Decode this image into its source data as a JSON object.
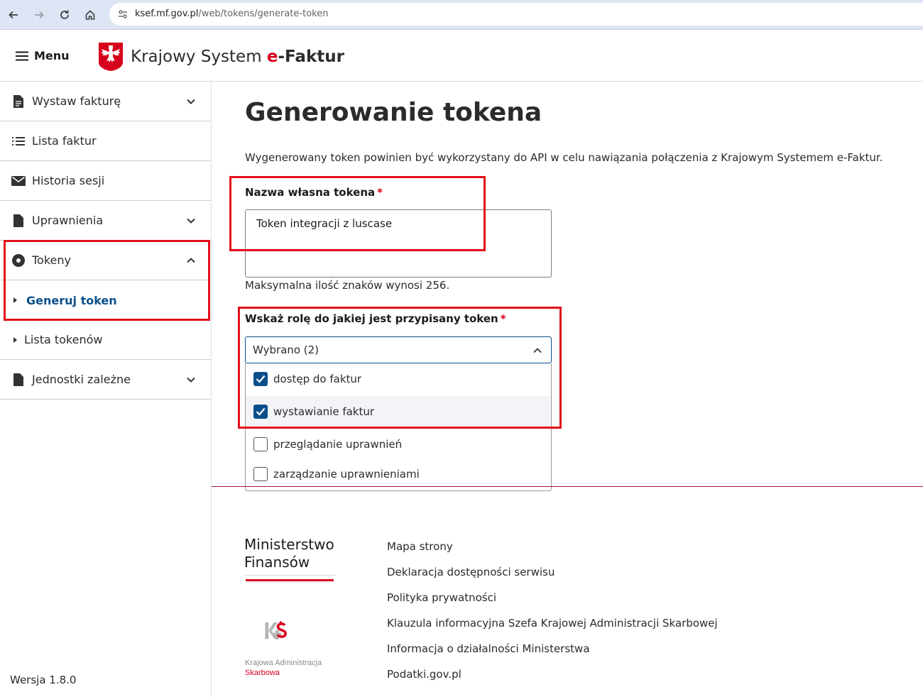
{
  "browser": {
    "url_host": "ksef.mf.gov.pl",
    "url_path": "/web/tokens/generate-token"
  },
  "header": {
    "menu_label": "Menu",
    "brand_part1": "Krajowy System ",
    "brand_e": "e",
    "brand_part2": "-Faktur"
  },
  "sidebar": {
    "items": [
      {
        "label": "Wystaw fakturę",
        "icon": "document-icon",
        "expandable": true
      },
      {
        "label": "Lista faktur",
        "icon": "list-icon",
        "expandable": false
      },
      {
        "label": "Historia sesji",
        "icon": "mail-icon",
        "expandable": false
      },
      {
        "label": "Uprawnienia",
        "icon": "document-icon",
        "expandable": true
      },
      {
        "label": "Tokeny",
        "icon": "token-icon",
        "expandable": true,
        "expanded": true
      }
    ],
    "sub_items": [
      {
        "label": "Generuj token",
        "active": true
      },
      {
        "label": "Lista tokenów",
        "active": false
      }
    ],
    "last_item": {
      "label": "Jednostki zależne",
      "icon": "document-icon",
      "expandable": true
    },
    "version": "Wersja 1.8.0"
  },
  "main": {
    "title": "Generowanie tokena",
    "description": "Wygenerowany token powinien być wykorzystany do API w celu nawiązania połączenia z Krajowym Systemem e-Faktur.",
    "name_label": "Nazwa własna tokena",
    "required_mark": "*",
    "name_value": "Token integracji z luscase",
    "hint": "Maksymalna ilość znaków wynosi 256.",
    "role_label": "Wskaż rolę do jakiej jest przypisany token",
    "role_selected": "Wybrano (2)",
    "role_options": [
      {
        "label": "dostęp do faktur",
        "checked": true
      },
      {
        "label": "wystawianie faktur",
        "checked": true
      },
      {
        "label": "przeglądanie uprawnień",
        "checked": false
      },
      {
        "label": "zarządzanie uprawnieniami",
        "checked": false
      }
    ]
  },
  "footer": {
    "mf_line1": "Ministerstwo",
    "mf_line2": "Finansów",
    "kas_line1": "Krajowa Administracja",
    "kas_line2": "Skarbowa",
    "links": [
      "Mapa strony",
      "Deklaracja dostępności serwisu",
      "Polityka prywatności",
      "Klauzula informacyjna Szefa Krajowej Administracji Skarbowej",
      "Informacja o działalności Ministerstwa",
      "Podatki.gov.pl"
    ]
  },
  "colors": {
    "brand_red": "#d7001c",
    "active_blue": "#0b4f8a",
    "annotation_red": "#e0101a",
    "divider": "#a3173a"
  }
}
